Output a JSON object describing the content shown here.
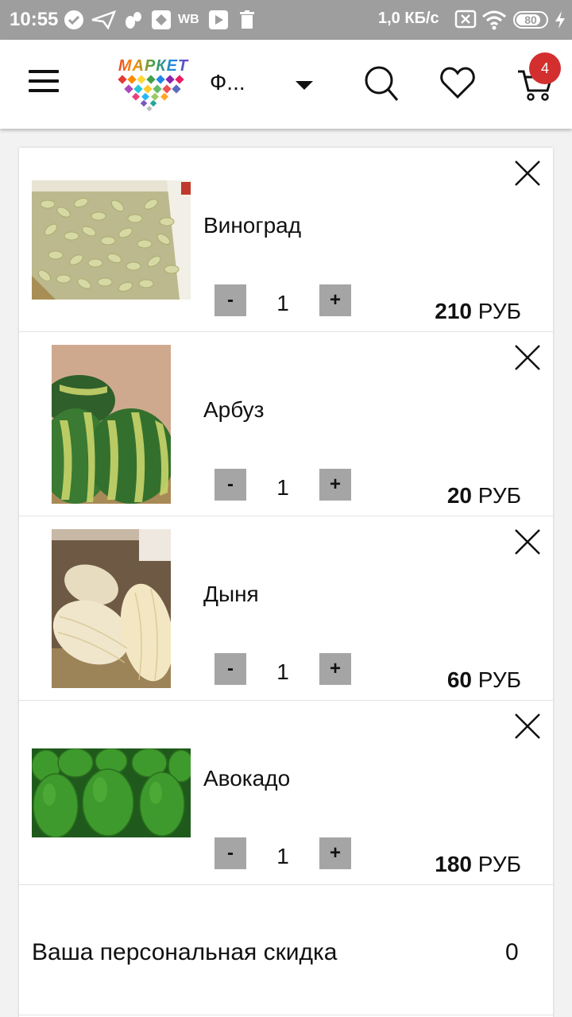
{
  "status_bar": {
    "time": "10:55",
    "wb_label": "WB",
    "network_speed": "1,0 КБ/с",
    "battery": "80"
  },
  "header": {
    "logo_text": "МАРКЕТ",
    "category": "Ф...",
    "cart_count": "4"
  },
  "cart": {
    "items": [
      {
        "name": "Виноград",
        "qty": "1",
        "price": "210",
        "currency": "РУБ",
        "minus": "-",
        "plus": "+"
      },
      {
        "name": "Арбуз",
        "qty": "1",
        "price": "20",
        "currency": "РУБ",
        "minus": "-",
        "plus": "+"
      },
      {
        "name": "Дыня",
        "qty": "1",
        "price": "60",
        "currency": "РУБ",
        "minus": "-",
        "plus": "+"
      },
      {
        "name": "Авокадо",
        "qty": "1",
        "price": "180",
        "currency": "РУБ",
        "minus": "-",
        "plus": "+"
      }
    ],
    "discount_label": "Ваша персональная скидка",
    "discount_value": "0"
  },
  "colors": {
    "status_bar": "#9e9e9e",
    "badge": "#d32f2f",
    "qty_button": "#a5a5a5"
  }
}
